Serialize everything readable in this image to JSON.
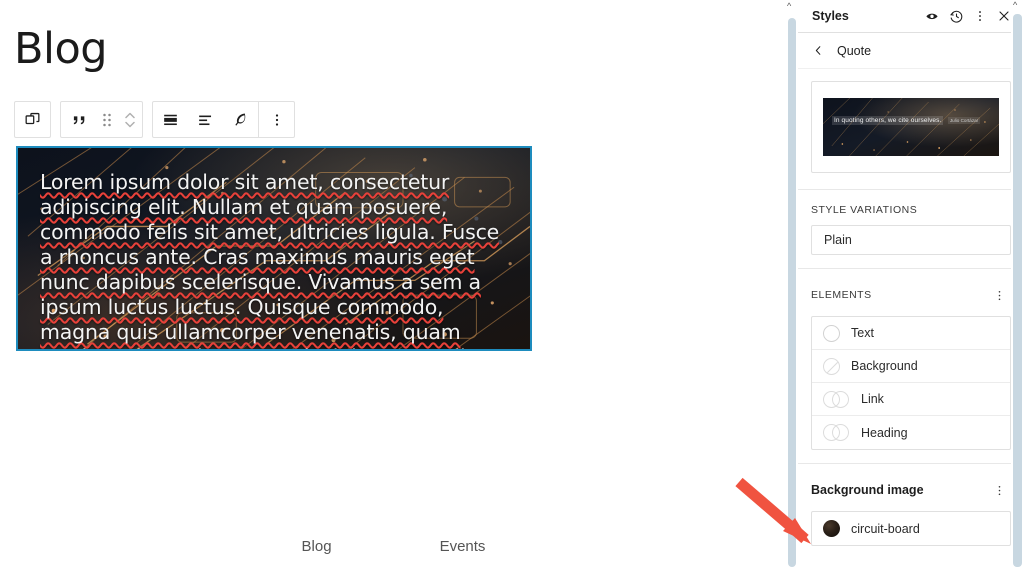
{
  "editor": {
    "page_title": "Blog",
    "quote_block": {
      "text": "Lorem ipsum dolor sit amet, consectetur adipiscing elit. Nullam et quam posuere, commodo felis sit amet, ultricies ligula. Fusce a rhoncus ante. Cras maximus mauris eget nunc dapibus scelerisque. Vivamus a sem a ipsum luctus luctus. Quisque commodo, magna quis ullamcorper venenatis, quam turpis malesuada magna, lacinia ornare diam nisi.",
      "selected_border_color": "#1e8cbe",
      "background_image_name": "circuit-board",
      "spellcheck_underline_color": "#e8413a"
    },
    "block_toolbar": {
      "buttons": [
        {
          "name": "select-parent-block",
          "icon": "copy-blocks-icon",
          "label": "Select parent block"
        },
        {
          "name": "block-type",
          "icon": "quote-icon",
          "label": "Quote"
        },
        {
          "name": "drag-handle",
          "icon": "drag-dots-icon",
          "label": "Drag"
        },
        {
          "name": "move-updown",
          "icon": "chevron-up-down-icon",
          "label": "Move up or down"
        },
        {
          "name": "align",
          "icon": "align-full-icon",
          "label": "Align"
        },
        {
          "name": "text-align",
          "icon": "text-align-left-icon",
          "label": "Align text"
        },
        {
          "name": "highlight",
          "icon": "feather-pen-icon",
          "label": "Highlight"
        },
        {
          "name": "more-options",
          "icon": "three-dots-vertical-icon",
          "label": "Options"
        }
      ]
    },
    "footer_nav": [
      {
        "label": "Blog"
      },
      {
        "label": "Events"
      }
    ]
  },
  "sidebar": {
    "header": {
      "title": "Styles",
      "actions": [
        {
          "name": "style-book-button",
          "icon": "eye-icon"
        },
        {
          "name": "revisions-button",
          "icon": "clock-revision-icon"
        },
        {
          "name": "more-styles-actions-button",
          "icon": "three-dots-vertical-icon"
        },
        {
          "name": "close-styles-button",
          "icon": "close-icon"
        }
      ]
    },
    "breadcrumb": {
      "back_icon": "chevron-left-icon",
      "label": "Quote"
    },
    "preview": {
      "quote_text": "In quoting others, we cite ourselves.",
      "citation": "Julio Cortázar"
    },
    "style_variations": {
      "heading": "STYLE VARIATIONS",
      "selected": "Plain"
    },
    "elements": {
      "heading": "ELEMENTS",
      "menu_icon": "three-dots-vertical-icon",
      "items": [
        {
          "label": "Text",
          "swatch": "single-circle"
        },
        {
          "label": "Background",
          "swatch": "slashed-circle"
        },
        {
          "label": "Link",
          "swatch": "double-circle"
        },
        {
          "label": "Heading",
          "swatch": "double-circle"
        }
      ]
    },
    "background_image": {
      "heading": "Background image",
      "menu_icon": "three-dots-vertical-icon",
      "item": {
        "label": "circuit-board",
        "swatch_color": "#1a120c"
      }
    }
  },
  "annotation": {
    "arrow_color": "#f05340",
    "points_to": "background-image-section"
  }
}
